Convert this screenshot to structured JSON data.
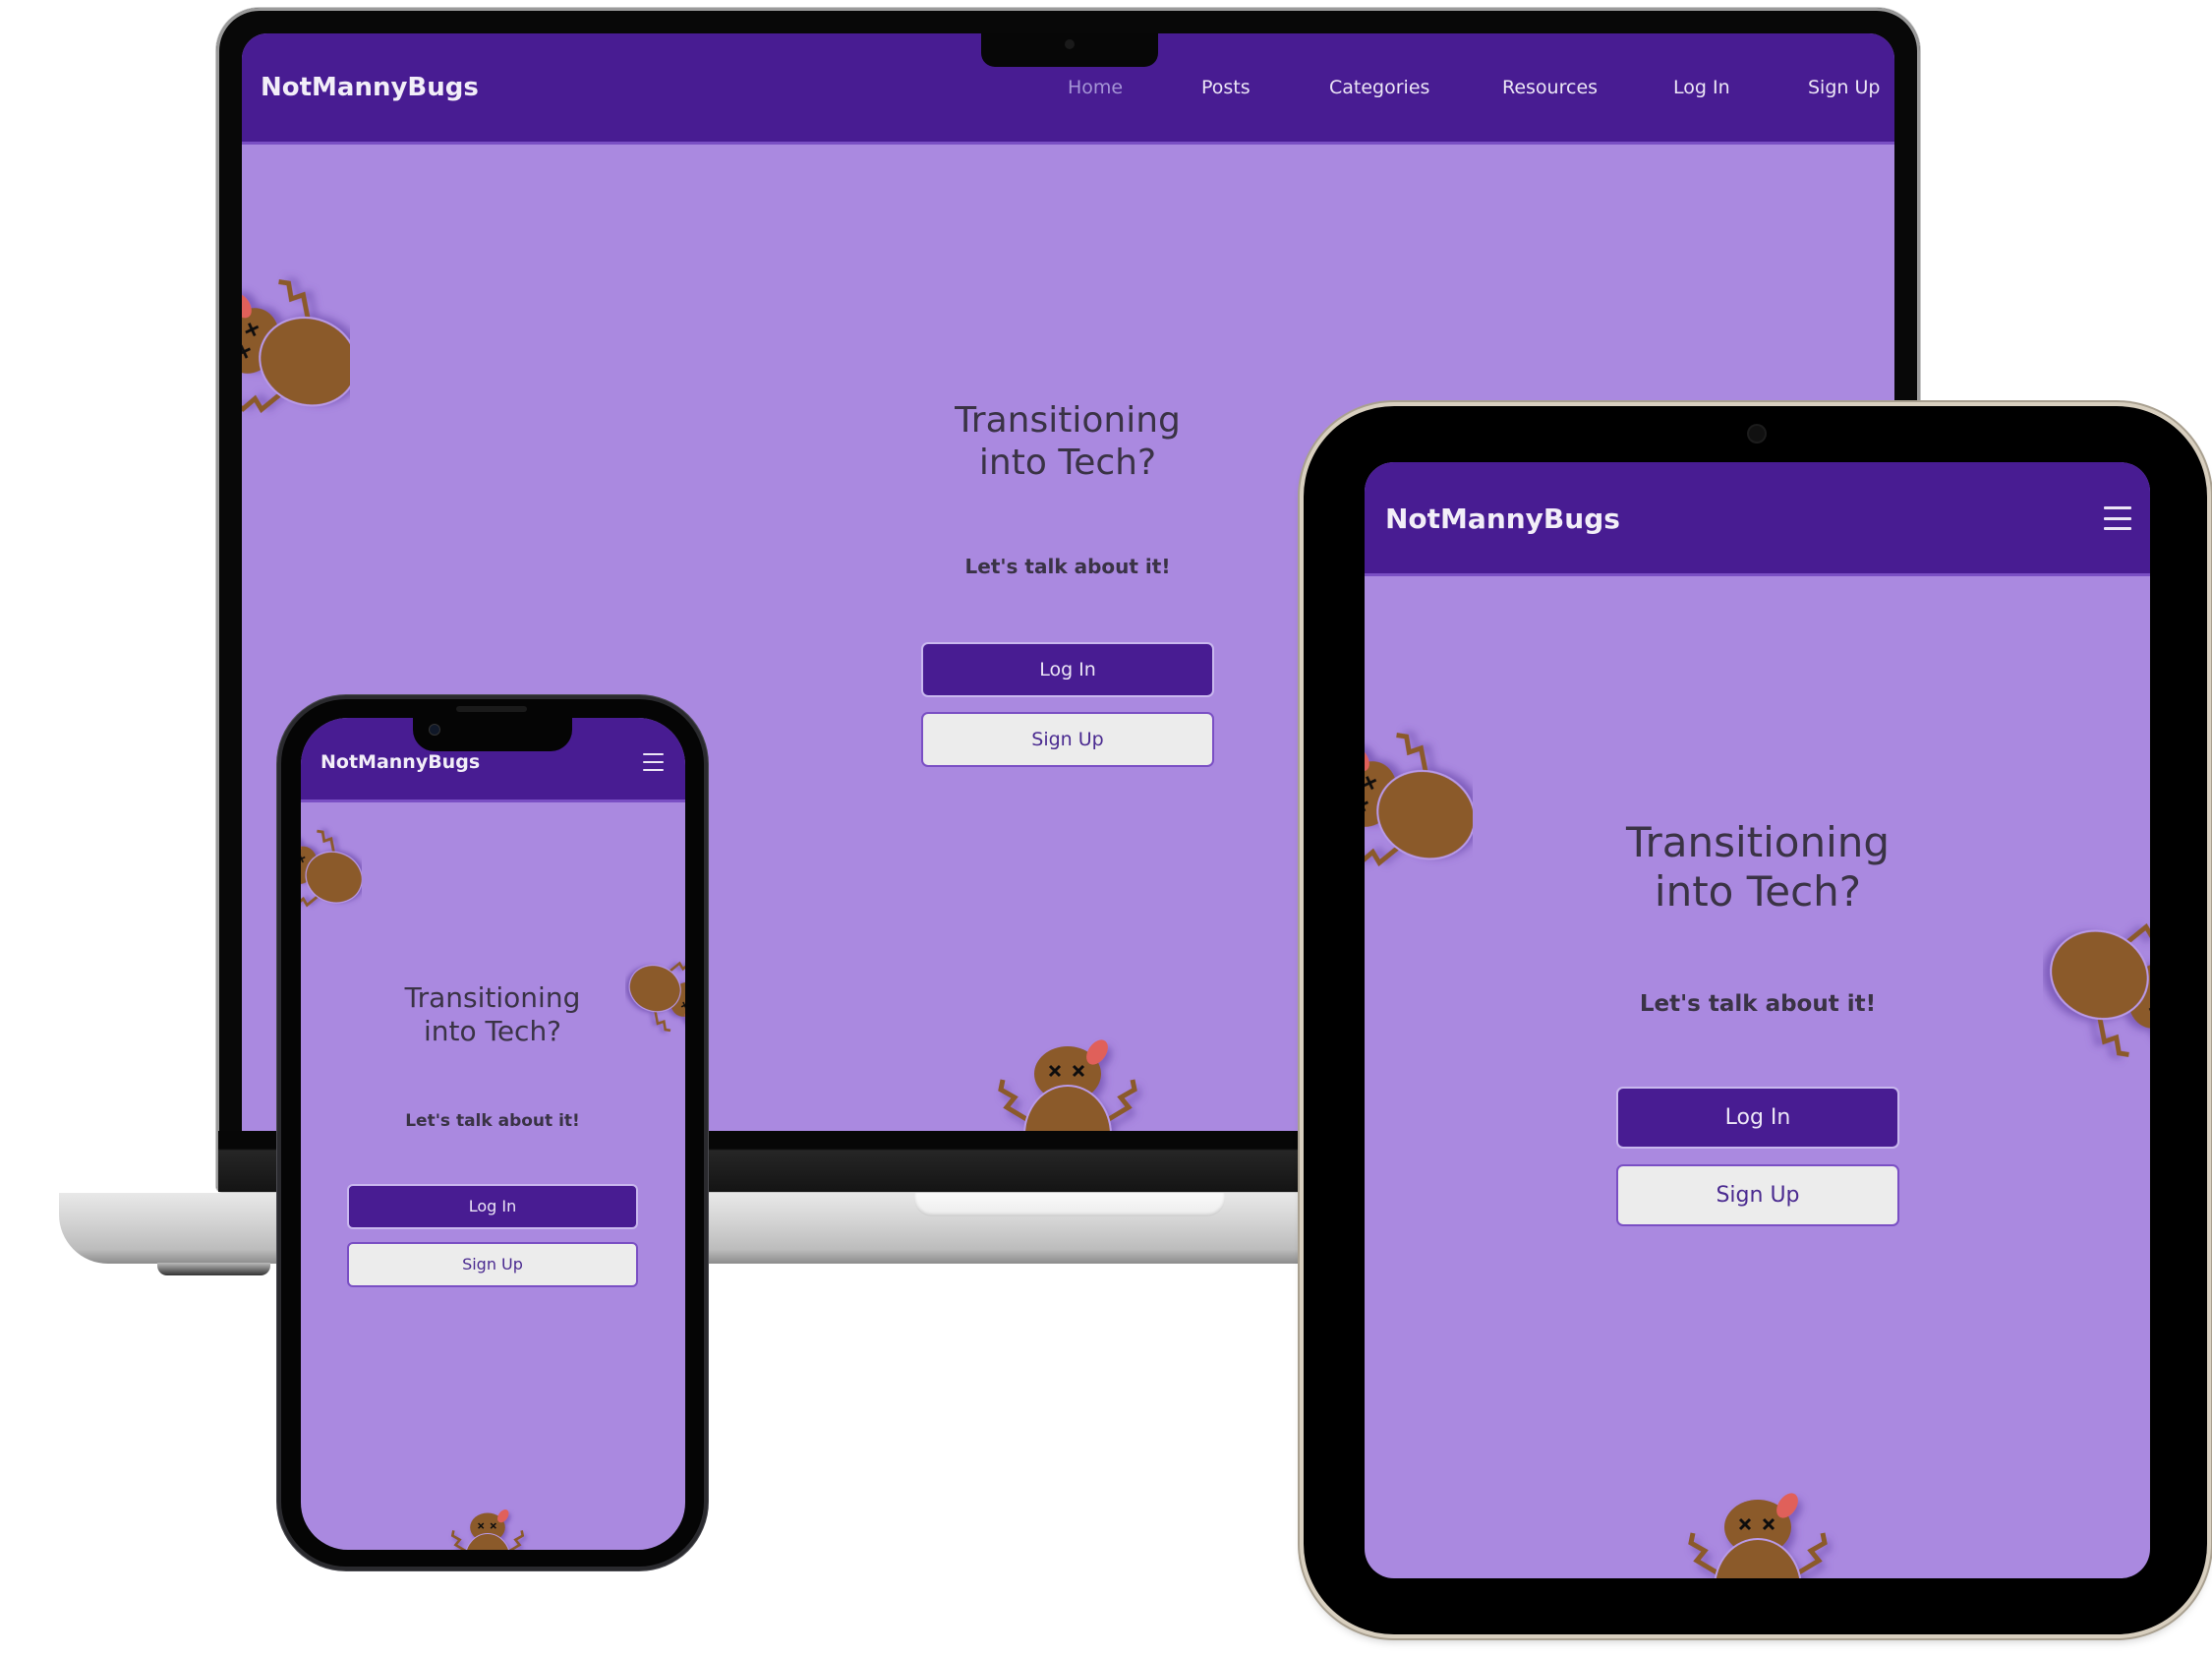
{
  "site": {
    "brand": "NotMannyBugs",
    "colors": {
      "nav_bg": "#481c92",
      "page_bg": "#aa89e0",
      "text_dark": "#3a3345",
      "bug_body": "#8b5a2b",
      "bug_tongue": "#e0605a",
      "button_secondary_bg": "#ececec"
    }
  },
  "laptop": {
    "nav": {
      "brand": "NotMannyBugs",
      "links": [
        {
          "label": "Home",
          "active": true
        },
        {
          "label": "Posts",
          "active": false
        },
        {
          "label": "Categories",
          "active": false
        },
        {
          "label": "Resources",
          "active": false
        },
        {
          "label": "Log In",
          "active": false
        },
        {
          "label": "Sign Up",
          "active": false
        }
      ]
    },
    "hero": {
      "title_line1": "Transitioning",
      "title_line2": "into Tech?",
      "subtitle": "Let's talk about it!",
      "login_label": "Log In",
      "signup_label": "Sign Up"
    }
  },
  "tablet": {
    "nav": {
      "brand": "NotMannyBugs",
      "menu_icon": "hamburger-menu-icon"
    },
    "hero": {
      "title_line1": "Transitioning",
      "title_line2": "into Tech?",
      "subtitle": "Let's talk about it!",
      "login_label": "Log In",
      "signup_label": "Sign Up"
    }
  },
  "phone": {
    "nav": {
      "brand": "NotMannyBugs",
      "menu_icon": "hamburger-menu-icon"
    },
    "hero": {
      "title_line1": "Transitioning",
      "title_line2": "into Tech?",
      "subtitle": "Let's talk about it!",
      "login_label": "Log In",
      "signup_label": "Sign Up"
    }
  }
}
